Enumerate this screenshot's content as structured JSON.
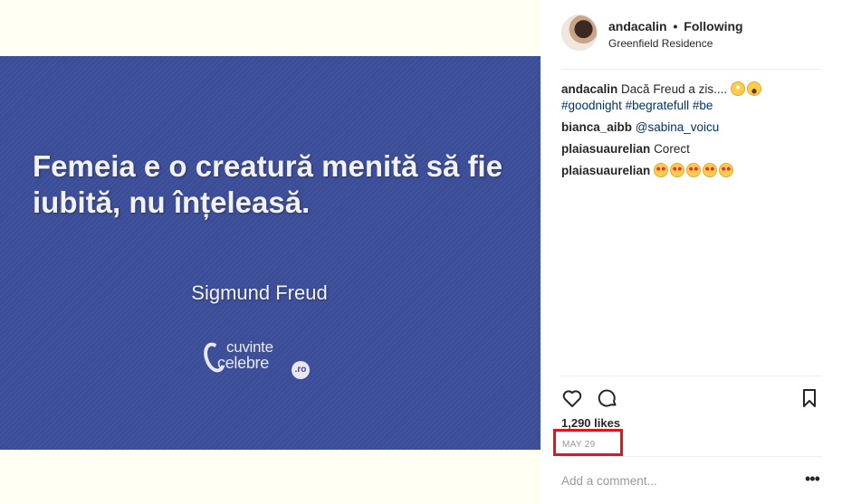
{
  "post_image": {
    "quote": "Femeia e o creatură menită să fie iubită, nu înțeleasă.",
    "author": "Sigmund Freud",
    "logo": {
      "word1": "cuvinte",
      "word2": "celebre",
      "tld": ".ro"
    },
    "background_color": "#3b4d98"
  },
  "header": {
    "username": "andacalin",
    "separator": "•",
    "follow_status": "Following",
    "location": "Greenfield Residence"
  },
  "comments": [
    {
      "user": "andacalin",
      "text": "Dacă Freud a zis....",
      "emojis": [
        "face-with-rolling-eyes",
        "grinning-squinting-face"
      ],
      "hashtags": "#goodnight #begratefull #be"
    },
    {
      "user": "bianca_aibb",
      "mention": "@sabina_voicu"
    },
    {
      "user": "plaiasuaurelian",
      "text": "Corect"
    },
    {
      "user": "plaiasuaurelian",
      "emojis": [
        "heart-eyes",
        "heart-eyes",
        "heart-eyes",
        "heart-eyes",
        "heart-eyes"
      ]
    }
  ],
  "actions": {
    "icons": [
      "heart-icon",
      "comment-icon",
      "bookmark-icon"
    ]
  },
  "likes": "1,290 likes",
  "date": "MAY 29",
  "add_comment_placeholder": "Add a comment...",
  "more_label": "•••",
  "colors": {
    "hashtag": "#003569",
    "highlight_box": "#e3141b",
    "muted": "#999999"
  }
}
